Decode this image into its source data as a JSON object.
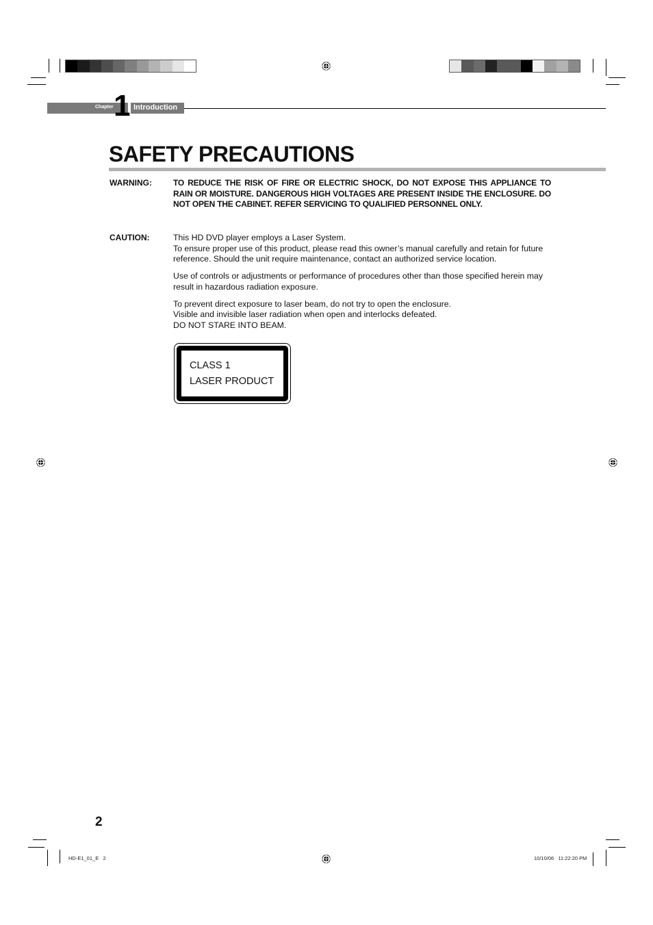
{
  "header": {
    "chapter_label": "Chapter",
    "chapter_number": "1",
    "chapter_title": "Introduction"
  },
  "color_bars": {
    "left": [
      "#000000",
      "#1a1a1a",
      "#333333",
      "#4d4d4d",
      "#666666",
      "#7f7f7f",
      "#999999",
      "#b3b3b3",
      "#cccccc",
      "#e6e6e6",
      "#ffffff"
    ],
    "right": [
      "#e6e6e6",
      "#595959",
      "#6b6b6b",
      "#222222",
      "#595959",
      "#595959",
      "#000000",
      "#f2f2f2",
      "#a1a1a1",
      "#b3b3b3",
      "#8a8a8a"
    ]
  },
  "page_title": "SAFETY PRECAUTIONS",
  "warning": {
    "label": "WARNING:",
    "text": "TO REDUCE THE RISK OF FIRE OR ELECTRIC SHOCK, DO NOT EXPOSE THIS APPLIANCE TO RAIN OR MOISTURE. DANGEROUS HIGH VOLTAGES ARE PRESENT INSIDE THE ENCLOSURE. DO NOT OPEN THE CABINET. REFER SERVICING TO QUALIFIED PERSONNEL ONLY."
  },
  "caution": {
    "label": "CAUTION:",
    "paragraphs": [
      [
        "This HD DVD player employs a Laser System.",
        "To ensure proper use of this product, please read this owner’s manual carefully and retain for future reference. Should the unit require maintenance, contact an authorized service location."
      ],
      [
        "Use of controls or adjustments or performance of procedures other than those specified herein may result in hazardous radiation exposure."
      ],
      [
        "To prevent direct exposure to laser beam, do not try to open the enclosure.",
        "Visible and invisible laser radiation when open and interlocks defeated.",
        "DO NOT STARE INTO BEAM."
      ]
    ]
  },
  "laser_label": {
    "line1": "CLASS 1",
    "line2": "LASER PRODUCT"
  },
  "page_number": "2",
  "footer": {
    "file": "HD-E1_01_E   2",
    "timestamp": "10/10/06   11:22:20 PM"
  }
}
